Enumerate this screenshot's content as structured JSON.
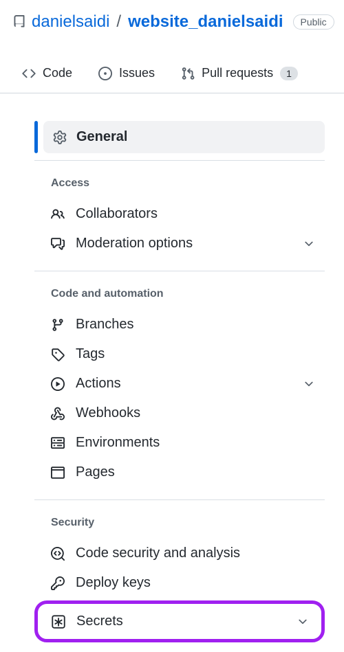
{
  "header": {
    "owner": "danielsaidi",
    "repo": "website_danielsaidi",
    "visibility": "Public"
  },
  "tabs": {
    "code": "Code",
    "issues": "Issues",
    "pulls": "Pull requests",
    "pulls_count": "1"
  },
  "sidebar": {
    "general": "General",
    "sections": {
      "access": {
        "heading": "Access",
        "collaborators": "Collaborators",
        "moderation": "Moderation options"
      },
      "code_automation": {
        "heading": "Code and automation",
        "branches": "Branches",
        "tags": "Tags",
        "actions": "Actions",
        "webhooks": "Webhooks",
        "environments": "Environments",
        "pages": "Pages"
      },
      "security": {
        "heading": "Security",
        "code_security": "Code security and analysis",
        "deploy_keys": "Deploy keys",
        "secrets": "Secrets"
      }
    }
  }
}
